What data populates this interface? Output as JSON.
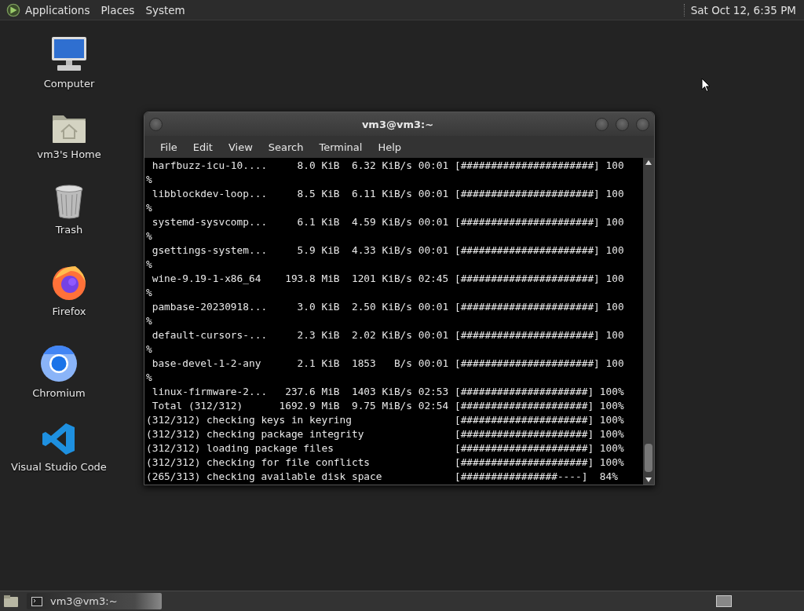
{
  "top_panel": {
    "menus": [
      "Applications",
      "Places",
      "System"
    ],
    "clock": "Sat Oct 12, 6:35 PM"
  },
  "desktop_icons": [
    {
      "label": "Computer",
      "kind": "computer"
    },
    {
      "label": "vm3's Home",
      "kind": "home"
    },
    {
      "label": "Trash",
      "kind": "trash"
    },
    {
      "label": "Firefox",
      "kind": "firefox"
    },
    {
      "label": "Chromium",
      "kind": "chromium"
    },
    {
      "label": "Visual Studio Code",
      "kind": "vscode"
    }
  ],
  "terminal": {
    "title": "vm3@vm3:~",
    "menu": [
      "File",
      "Edit",
      "View",
      "Search",
      "Terminal",
      "Help"
    ],
    "lines": [
      " harfbuzz-icu-10....     8.0 KiB  6.32 KiB/s 00:01 [######################] 100",
      "%",
      " libblockdev-loop...     8.5 KiB  6.11 KiB/s 00:01 [######################] 100",
      "%",
      " systemd-sysvcomp...     6.1 KiB  4.59 KiB/s 00:01 [######################] 100",
      "%",
      " gsettings-system...     5.9 KiB  4.33 KiB/s 00:01 [######################] 100",
      "%",
      " wine-9.19-1-x86_64    193.8 MiB  1201 KiB/s 02:45 [######################] 100",
      "%",
      " pambase-20230918...     3.0 KiB  2.50 KiB/s 00:01 [######################] 100",
      "%",
      " default-cursors-...     2.3 KiB  2.02 KiB/s 00:01 [######################] 100",
      "%",
      " base-devel-1-2-any      2.1 KiB  1853   B/s 00:01 [######################] 100",
      "%",
      " linux-firmware-2...   237.6 MiB  1403 KiB/s 02:53 [#####################] 100%",
      " Total (312/312)      1692.9 MiB  9.75 MiB/s 02:54 [#####################] 100%",
      "(312/312) checking keys in keyring                 [#####################] 100%",
      "(312/312) checking package integrity               [#####################] 100%",
      "(312/312) loading package files                    [#####################] 100%",
      "(312/312) checking for file conflicts              [#####################] 100%",
      "(265/313) checking available disk space            [################----]  84%"
    ]
  },
  "taskbar": {
    "tasks": [
      {
        "label": "vm3@vm3:~",
        "selected": true
      }
    ]
  }
}
